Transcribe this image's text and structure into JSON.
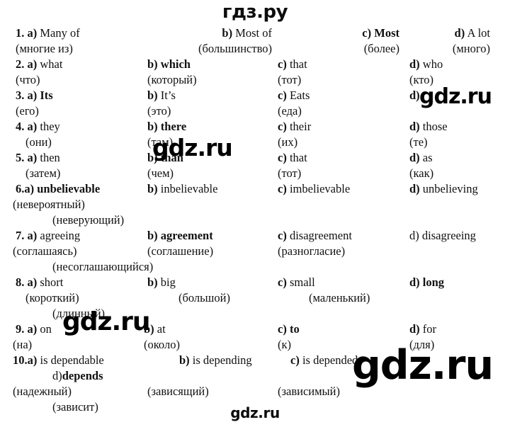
{
  "brand": {
    "header": "гдз.ру",
    "footer": "gdz.ru",
    "watermarks": [
      "gdz.ru",
      "gdz.ru",
      "gdz.ru",
      "gdz.ru"
    ]
  },
  "questions": [
    {
      "number": "1.",
      "options": [
        {
          "label": "a)",
          "label_bold": true,
          "text": "Many of",
          "text_bold": false,
          "ru": "(многие из)"
        },
        {
          "label": "b)",
          "label_bold": true,
          "text": "Most of",
          "text_bold": false,
          "ru": "(большинство)"
        },
        {
          "label": "c)",
          "label_bold": true,
          "text": "Most",
          "text_bold": true,
          "ru": "(более)"
        },
        {
          "label": "d)",
          "label_bold": true,
          "text": "A lot",
          "text_bold": false,
          "ru": "(много)"
        }
      ]
    },
    {
      "number": "2.",
      "options": [
        {
          "label": "a)",
          "label_bold": true,
          "text": "what",
          "text_bold": false,
          "ru": "(что)"
        },
        {
          "label": "b)",
          "label_bold": true,
          "text": "which",
          "text_bold": true,
          "ru": "(который)"
        },
        {
          "label": "c)",
          "label_bold": true,
          "text": "that",
          "text_bold": false,
          "ru": "(тот)"
        },
        {
          "label": "d)",
          "label_bold": true,
          "text": "who",
          "text_bold": false,
          "ru": "(кто)"
        }
      ]
    },
    {
      "number": "3.",
      "options": [
        {
          "label": "a)",
          "label_bold": true,
          "text": "Its",
          "text_bold": true,
          "ru": "(его)"
        },
        {
          "label": "b)",
          "label_bold": true,
          "text": "It’s",
          "text_bold": false,
          "ru": "(это)"
        },
        {
          "label": "c)",
          "label_bold": true,
          "text": "Eats",
          "text_bold": false,
          "ru": "(еда)"
        },
        {
          "label": "d)",
          "label_bold": true,
          "text": "",
          "text_bold": false,
          "ru": ""
        }
      ]
    },
    {
      "number": "4.",
      "options": [
        {
          "label": "a)",
          "label_bold": true,
          "text": "they",
          "text_bold": false,
          "ru": "(они)"
        },
        {
          "label": "b)",
          "label_bold": true,
          "text": "there",
          "text_bold": true,
          "ru": "(там)"
        },
        {
          "label": "c)",
          "label_bold": true,
          "text": "their",
          "text_bold": false,
          "ru": "(их)"
        },
        {
          "label": "d)",
          "label_bold": true,
          "text": "those",
          "text_bold": false,
          "ru": "(те)"
        }
      ]
    },
    {
      "number": "5.",
      "options": [
        {
          "label": "a)",
          "label_bold": true,
          "text": "then",
          "text_bold": false,
          "ru": "(затем)"
        },
        {
          "label": "b)",
          "label_bold": true,
          "text": "than",
          "text_bold": true,
          "ru": "(чем)"
        },
        {
          "label": "c)",
          "label_bold": true,
          "text": "that",
          "text_bold": false,
          "ru": "(тот)"
        },
        {
          "label": "d)",
          "label_bold": true,
          "text": "as",
          "text_bold": false,
          "ru": "(как)"
        }
      ]
    },
    {
      "number": "6.",
      "options": [
        {
          "label": "a)",
          "label_bold": true,
          "text": "unbelievable",
          "text_bold": true,
          "ru": "(невероятный)"
        },
        {
          "label": "b)",
          "label_bold": true,
          "text": "inbelievable",
          "text_bold": false,
          "ru": ""
        },
        {
          "label": "c)",
          "label_bold": true,
          "text": "imbelievable",
          "text_bold": false,
          "ru": ""
        },
        {
          "label": "d)",
          "label_bold": true,
          "text": "unbelieving",
          "text_bold": false,
          "ru": ""
        }
      ],
      "extra_ru": "(неверующий)"
    },
    {
      "number": "7.",
      "options": [
        {
          "label": "a)",
          "label_bold": true,
          "text": "agreeing",
          "text_bold": false,
          "ru": "(соглашаясь)"
        },
        {
          "label": "b)",
          "label_bold": true,
          "text": "agreement",
          "text_bold": true,
          "ru": "(соглашение)"
        },
        {
          "label": "c)",
          "label_bold": true,
          "text": "disagreement",
          "text_bold": false,
          "ru": "(разногласие)"
        },
        {
          "label": "d)",
          "label_bold": false,
          "text": "disagreeing",
          "text_bold": false,
          "ru": ""
        }
      ],
      "extra_ru": "(несоглашающийся)"
    },
    {
      "number": "8.",
      "options": [
        {
          "label": "a)",
          "label_bold": true,
          "text": "short",
          "text_bold": false,
          "ru": "(короткий)"
        },
        {
          "label": "b)",
          "label_bold": true,
          "text": "big",
          "text_bold": false,
          "ru": "(большой)"
        },
        {
          "label": "c)",
          "label_bold": true,
          "text": "small",
          "text_bold": false,
          "ru": "(маленький)"
        },
        {
          "label": "d)",
          "label_bold": true,
          "text": "long",
          "text_bold": true,
          "ru": ""
        }
      ],
      "extra_ru": "(длинный)"
    },
    {
      "number": "9.",
      "options": [
        {
          "label": "a)",
          "label_bold": true,
          "text": "on",
          "text_bold": false,
          "ru": "(на)"
        },
        {
          "label": "b)",
          "label_bold": true,
          "text": "at",
          "text_bold": false,
          "ru": "(около)"
        },
        {
          "label": "c)",
          "label_bold": true,
          "text": "to",
          "text_bold": true,
          "ru": "(к)"
        },
        {
          "label": "d)",
          "label_bold": true,
          "text": "for",
          "text_bold": false,
          "ru": "(для)"
        }
      ]
    },
    {
      "number": "10.",
      "options": [
        {
          "label": "a)",
          "label_bold": true,
          "text": "is dependable",
          "text_bold": false,
          "ru": "(надежный)"
        },
        {
          "label": "b)",
          "label_bold": true,
          "text": "is depending",
          "text_bold": false,
          "ru": "(зависящий)"
        },
        {
          "label": "c)",
          "label_bold": true,
          "text": "is depended",
          "text_bold": false,
          "ru": "(зависимый)"
        },
        {
          "label": "d)",
          "label_bold": false,
          "text": "depends",
          "text_bold": true,
          "ru": ""
        }
      ],
      "extra_ru": "(зависит)"
    }
  ]
}
